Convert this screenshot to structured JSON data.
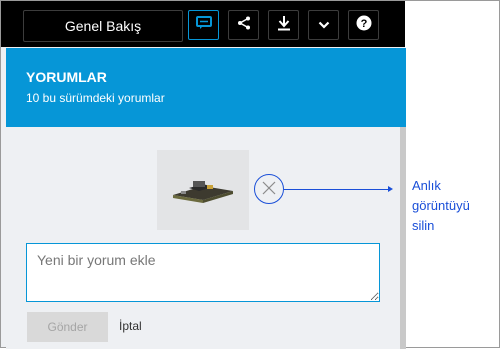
{
  "toolbar": {
    "tab_label": "Genel Bakış",
    "buttons": [
      {
        "name": "comments",
        "icon": "comment-icon",
        "active": true
      },
      {
        "name": "share",
        "icon": "share-icon"
      },
      {
        "name": "download",
        "icon": "download-icon"
      },
      {
        "name": "more",
        "icon": "chevron-down-icon"
      },
      {
        "name": "help",
        "icon": "help-icon"
      }
    ]
  },
  "header": {
    "title": "YORUMLAR",
    "subtitle": "10 bu sürümdeki yorumlar"
  },
  "comment_form": {
    "placeholder": "Yeni bir yorum ekle",
    "value": "",
    "send_label": "Gönder",
    "cancel_label": "İptal"
  },
  "snapshot": {
    "remove_icon": "close-circle-icon"
  },
  "callout": {
    "text": "Anlık görüntüyü silin"
  },
  "colors": {
    "toolbar_bg": "#000000",
    "accent": "#0696d7",
    "callout": "#1a4fd8",
    "panel_bg": "#eef0f3"
  }
}
